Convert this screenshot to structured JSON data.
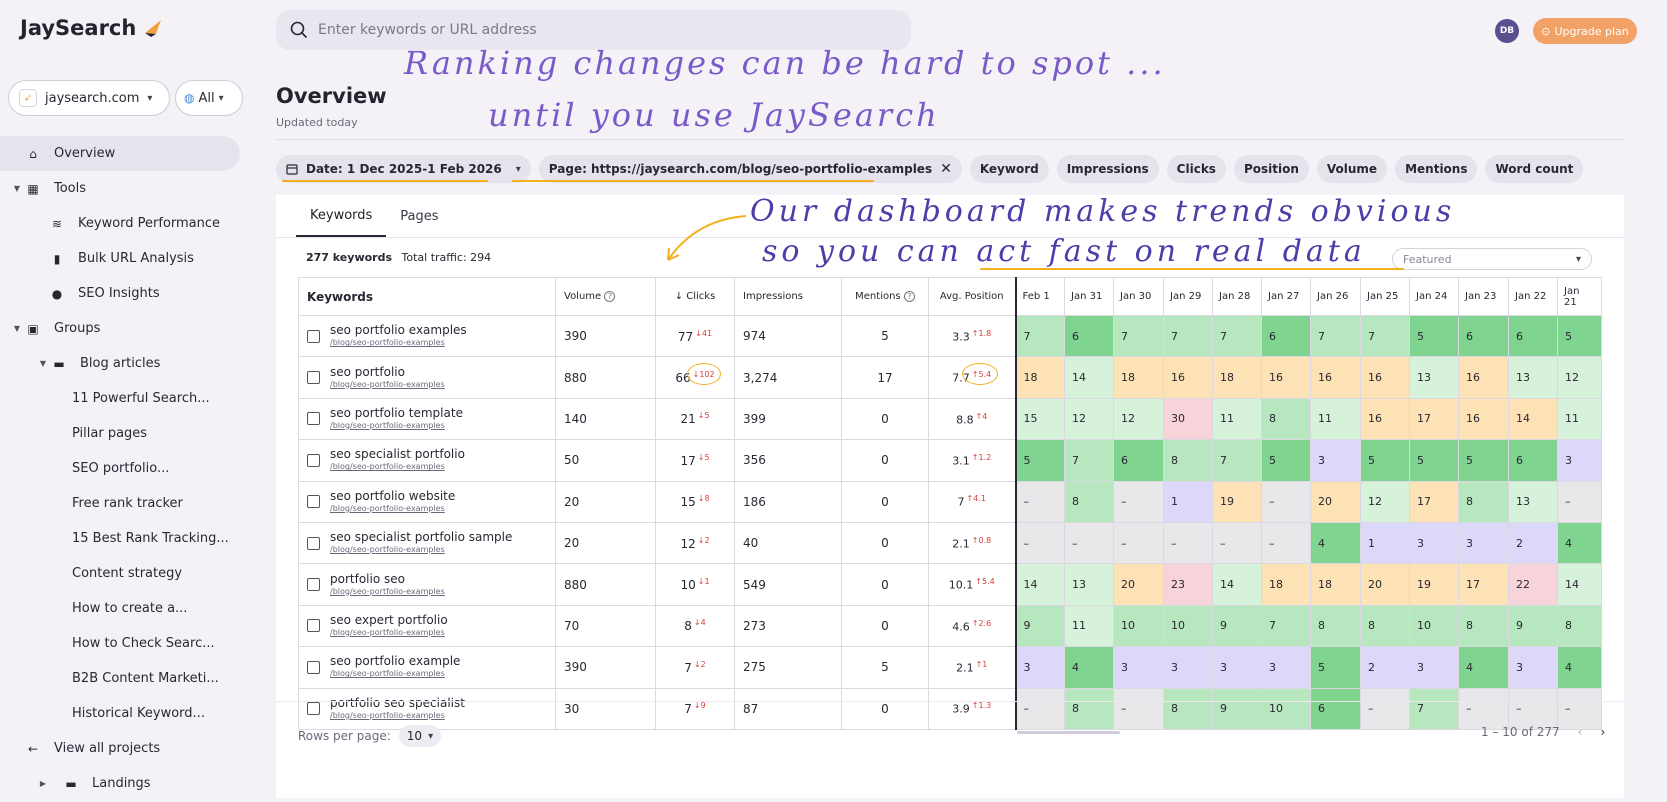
{
  "app": {
    "name": "JaySearch"
  },
  "search": {
    "placeholder": "Enter keywords or URL address"
  },
  "user": {
    "initials": "DB",
    "upgrade_label": "Upgrade plan"
  },
  "project": {
    "name": "jaysearch.com",
    "scope": "All"
  },
  "sidebar": {
    "items": [
      {
        "label": "Overview",
        "icon": "home-icon"
      },
      {
        "label": "Tools",
        "icon": "grid-icon"
      },
      {
        "label": "Keyword Performance",
        "icon": "signal-icon"
      },
      {
        "label": "Bulk URL Analysis",
        "icon": "bulk-icon"
      },
      {
        "label": "SEO Insights",
        "icon": "insight-icon"
      },
      {
        "label": "Groups",
        "icon": "image-icon"
      },
      {
        "label": "Blog articles",
        "icon": "folder-icon"
      },
      {
        "label": "11 Powerful Search..."
      },
      {
        "label": "Pillar pages"
      },
      {
        "label": "SEO portfolio..."
      },
      {
        "label": "Free rank tracker"
      },
      {
        "label": "15 Best Rank Tracking..."
      },
      {
        "label": "Content strategy"
      },
      {
        "label": "How to create a..."
      },
      {
        "label": "How to Check Searc..."
      },
      {
        "label": "B2B Content Marketi..."
      },
      {
        "label": "Historical Keyword..."
      },
      {
        "label": "View all projects",
        "icon": "arrow-left-icon"
      },
      {
        "label": "Landings"
      }
    ]
  },
  "page": {
    "title": "Overview",
    "subtitle": "Updated today"
  },
  "annotations": {
    "line1": "Ranking changes can be hard to spot ...",
    "line2": "until you use JaySearch",
    "line3": "Our dashboard makes trends obvious",
    "line4": "so you can act fast on real data"
  },
  "filters": {
    "date": "Date: 1 Dec 2025-1 Feb 2026",
    "page": "Page: https://jaysearch.com/blog/seo-portfolio-examples",
    "columns": [
      "Keyword",
      "Impressions",
      "Clicks",
      "Position",
      "Volume",
      "Mentions",
      "Word count"
    ]
  },
  "tabs": [
    "Keywords",
    "Pages"
  ],
  "summary": {
    "keywords": "277 keywords",
    "traffic": "Total traffic: 294"
  },
  "sort": {
    "value": "Featured"
  },
  "table": {
    "headers": {
      "keywords": "Keywords",
      "volume": "Volume",
      "clicks": "Clicks",
      "impressions": "Impressions",
      "mentions": "Mentions",
      "position": "Avg. Position"
    },
    "days": [
      "Feb 1",
      "Jan 31",
      "Jan 30",
      "Jan 29",
      "Jan 28",
      "Jan 27",
      "Jan 26",
      "Jan 25",
      "Jan 24",
      "Jan 23",
      "Jan 22",
      "Jan 21"
    ],
    "rows": [
      {
        "keyword": "seo portfolio examples",
        "url": "/blog/seo-portfolio-examples",
        "volume": "390",
        "clicks": "77",
        "clicks_delta": "↓41",
        "impressions": "974",
        "mentions": "5",
        "position": "3.3",
        "position_delta": "↑1.8",
        "days": [
          "7",
          "6",
          "7",
          "7",
          "7",
          "6",
          "7",
          "7",
          "5",
          "6",
          "6",
          "5"
        ],
        "colors": [
          "lg",
          "dg",
          "lg",
          "lg",
          "lg",
          "dg",
          "lg",
          "lg",
          "dg",
          "dg",
          "dg",
          "dg"
        ]
      },
      {
        "keyword": "seo portfolio",
        "url": "/blog/seo-portfolio-examples",
        "volume": "880",
        "clicks": "66",
        "clicks_delta": "↓102",
        "impressions": "3,274",
        "mentions": "17",
        "position": "7.7",
        "position_delta": "↑5.4",
        "days": [
          "18",
          "14",
          "18",
          "16",
          "18",
          "16",
          "16",
          "16",
          "13",
          "16",
          "13",
          "12"
        ],
        "colors": [
          "or",
          "vlg",
          "or",
          "or",
          "or",
          "or",
          "or",
          "or",
          "vlg",
          "or",
          "vlg",
          "vlg"
        ]
      },
      {
        "keyword": "seo portfolio template",
        "url": "/blog/seo-portfolio-examples",
        "volume": "140",
        "clicks": "21",
        "clicks_delta": "↓5",
        "impressions": "399",
        "mentions": "0",
        "position": "8.8",
        "position_delta": "↑4",
        "days": [
          "15",
          "12",
          "12",
          "30",
          "11",
          "8",
          "11",
          "16",
          "17",
          "16",
          "14",
          "11"
        ],
        "colors": [
          "vlg",
          "vlg",
          "vlg",
          "pk",
          "vlg",
          "lg",
          "vlg",
          "or",
          "or",
          "or",
          "or",
          "vlg"
        ]
      },
      {
        "keyword": "seo specialist portfolio",
        "url": "/blog/seo-portfolio-examples",
        "volume": "50",
        "clicks": "17",
        "clicks_delta": "↓5",
        "impressions": "356",
        "mentions": "0",
        "position": "3.1",
        "position_delta": "↑1.2",
        "days": [
          "5",
          "7",
          "6",
          "8",
          "7",
          "5",
          "3",
          "5",
          "5",
          "5",
          "6",
          "3"
        ],
        "colors": [
          "dg",
          "lg",
          "dg",
          "lg",
          "lg",
          "dg",
          "pu",
          "dg",
          "dg",
          "dg",
          "dg",
          "pu"
        ]
      },
      {
        "keyword": "seo portfolio website",
        "url": "/blog/seo-portfolio-examples",
        "volume": "20",
        "clicks": "15",
        "clicks_delta": "↓8",
        "impressions": "186",
        "mentions": "0",
        "position": "7",
        "position_delta": "↑4.1",
        "days": [
          "–",
          "8",
          "–",
          "1",
          "19",
          "–",
          "20",
          "12",
          "17",
          "8",
          "13",
          "–"
        ],
        "colors": [
          "gy",
          "lg",
          "gy",
          "pu",
          "or",
          "gy",
          "or",
          "vlg",
          "or",
          "lg",
          "vlg",
          "gy"
        ]
      },
      {
        "keyword": "seo specialist portfolio sample",
        "url": "/blog/seo-portfolio-examples",
        "volume": "20",
        "clicks": "12",
        "clicks_delta": "↓2",
        "impressions": "40",
        "mentions": "0",
        "position": "2.1",
        "position_delta": "↑0.8",
        "days": [
          "–",
          "–",
          "–",
          "–",
          "–",
          "–",
          "4",
          "1",
          "3",
          "3",
          "2",
          "4"
        ],
        "colors": [
          "gy",
          "gy",
          "gy",
          "gy",
          "gy",
          "gy",
          "dg",
          "pu",
          "pu",
          "pu",
          "pu",
          "dg"
        ]
      },
      {
        "keyword": "portfolio seo",
        "url": "/blog/seo-portfolio-examples",
        "volume": "880",
        "clicks": "10",
        "clicks_delta": "↓1",
        "impressions": "549",
        "mentions": "0",
        "position": "10.1",
        "position_delta": "↑5.4",
        "days": [
          "14",
          "13",
          "20",
          "23",
          "14",
          "18",
          "18",
          "20",
          "19",
          "17",
          "22",
          "14"
        ],
        "colors": [
          "vlg",
          "vlg",
          "or",
          "pk",
          "vlg",
          "or",
          "or",
          "or",
          "or",
          "or",
          "pk",
          "vlg"
        ]
      },
      {
        "keyword": "seo expert portfolio",
        "url": "/blog/seo-portfolio-examples",
        "volume": "70",
        "clicks": "8",
        "clicks_delta": "↓4",
        "impressions": "273",
        "mentions": "0",
        "position": "4.6",
        "position_delta": "↑2.6",
        "days": [
          "9",
          "11",
          "10",
          "10",
          "9",
          "7",
          "8",
          "8",
          "10",
          "8",
          "9",
          "8"
        ],
        "colors": [
          "lg",
          "vlg",
          "lg",
          "lg",
          "lg",
          "lg",
          "lg",
          "lg",
          "lg",
          "lg",
          "lg",
          "lg"
        ]
      },
      {
        "keyword": "seo portfolio example",
        "url": "/blog/seo-portfolio-examples",
        "volume": "390",
        "clicks": "7",
        "clicks_delta": "↓2",
        "impressions": "275",
        "mentions": "5",
        "position": "2.1",
        "position_delta": "↑1",
        "days": [
          "3",
          "4",
          "3",
          "3",
          "3",
          "3",
          "5",
          "2",
          "3",
          "4",
          "3",
          "4"
        ],
        "colors": [
          "pu",
          "dg",
          "pu",
          "pu",
          "pu",
          "pu",
          "dg",
          "pu",
          "pu",
          "dg",
          "pu",
          "dg"
        ]
      },
      {
        "keyword": "portfolio seo specialist",
        "url": "/blog/seo-portfolio-examples",
        "volume": "30",
        "clicks": "7",
        "clicks_delta": "↓9",
        "impressions": "87",
        "mentions": "0",
        "position": "3.9",
        "position_delta": "↑1.3",
        "days": [
          "–",
          "8",
          "–",
          "8",
          "9",
          "10",
          "6",
          "–",
          "7",
          "–",
          "–",
          "–"
        ],
        "colors": [
          "gy",
          "lg",
          "gy",
          "lg",
          "lg",
          "lg",
          "dg",
          "gy",
          "lg",
          "gy",
          "gy",
          "gy"
        ]
      }
    ]
  },
  "footer": {
    "rows_label": "Rows per page:",
    "rows_value": "10",
    "range": "1 – 10 of 277"
  },
  "colors": {
    "accent": "#f2a266",
    "annotation": "#f2b021",
    "handwriting": "#7a5ac8"
  }
}
